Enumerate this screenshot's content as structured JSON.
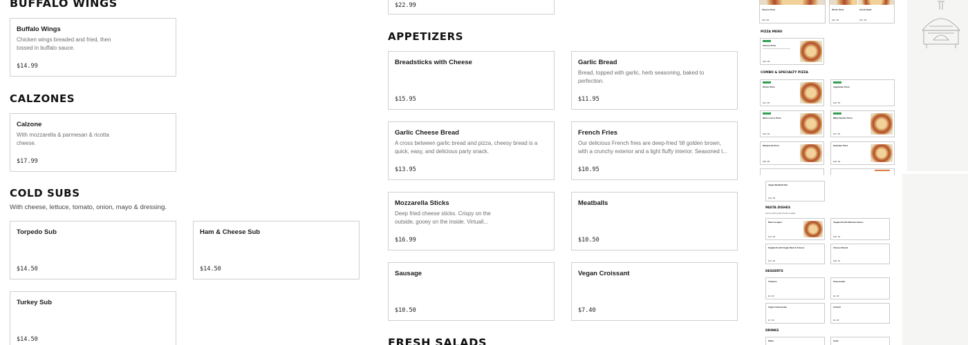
{
  "left_column": {
    "buffalo_heading": "BUFFALO WINGS",
    "buffalo_items": [
      {
        "name": "Buffalo Wings",
        "desc": "Chicken wings breaded and fried, then tossed in buffalo sauce.",
        "price": "$14.99"
      }
    ],
    "calzones_heading": "CALZONES",
    "calzone_items": [
      {
        "name": "Calzone",
        "desc": "With mozzarella & parmesan & ricotta cheese.",
        "price": "$17.99"
      }
    ],
    "cold_subs_heading": "COLD SUBS",
    "cold_subs_subtitle": "With cheese, lettuce, tomato, onion, mayo & dressing.",
    "cold_sub_items": [
      {
        "name": "Torpedo Sub",
        "price": "$14.50"
      },
      {
        "name": "Ham & Cheese Sub",
        "price": "$14.50"
      },
      {
        "name": "Turkey Sub",
        "price": "$14.50"
      }
    ]
  },
  "middle_column": {
    "top_fragment_price": "$22.99",
    "appetizers_heading": "APPETIZERS",
    "appetizer_items": [
      {
        "name": "Breadsticks with Cheese",
        "desc": "",
        "price": "$15.95"
      },
      {
        "name": "Garlic Bread",
        "desc": "Bread, topped with garlic, herb seasoning, baked to perfection.",
        "price": "$11.95"
      },
      {
        "name": "Garlic Cheese Bread",
        "desc": "A cross between garlic bread and pizza, cheesy bread is a quick, easy, and delicious party snack.",
        "price": "$13.95"
      },
      {
        "name": "French Fries",
        "desc": "Our delicious French fries are deep-fried 'till golden brown, with a crunchy exterior and a light fluffy interior. Seasoned t...",
        "price": "$10.95"
      },
      {
        "name": "Mozzarella Sticks",
        "desc": "Deep fried cheese sticks. Crispy on the outside, gooey on the inside. Virtuall...",
        "price": "$16.99"
      },
      {
        "name": "Meatballs",
        "desc": "",
        "price": "$10.50"
      },
      {
        "name": "Sausage",
        "desc": "",
        "price": "$10.50"
      },
      {
        "name": "Vegan Croissant",
        "desc": "",
        "price": "$7.40"
      }
    ],
    "fresh_salads_heading": "FRESH SALADS"
  },
  "thumbnail": {
    "sections": [
      "PIZZA MENU",
      "COMBO & SPECIALTY PIZZA",
      "PASTA DISHES",
      "DESSERTS",
      "DRINKS"
    ],
    "top_items": [
      {
        "name": "Cheese Pizza",
        "price": "$16.99"
      },
      {
        "name": "Works Pizza",
        "price": "$21.99"
      },
      {
        "name": "Greek Salad",
        "price": "$13.99"
      }
    ],
    "pizza_menu_items": [
      {
        "name": "Cheese Pizza",
        "price": "$16.99"
      }
    ],
    "combo_items": [
      {
        "name": "Works Pizza",
        "price": "$21.99"
      },
      {
        "name": "Vegetarian Pizza",
        "price": "$20.99"
      },
      {
        "name": "Meat Lover's Pizza",
        "price": "$20.99"
      },
      {
        "name": "BBQ Chicken Pizza",
        "price": "$21.99"
      },
      {
        "name": "Margherita Pizza",
        "price": "$20.99"
      },
      {
        "name": "Hawaiian Pizza",
        "price": "$20.99"
      }
    ],
    "vegan_item": {
      "name": "Vegan Meatball Sub",
      "price": "$15.99"
    },
    "pasta_subtitle": "Served with garlic bread & salad.",
    "pasta_items": [
      {
        "name": "Meat Lasagna",
        "price": "$21.99"
      },
      {
        "name": "Spaghetti with Marinara Sauce",
        "price": "$16.49"
      },
      {
        "name": "Spaghetti with Vegan Meat & Cheese",
        "price": "$21.99"
      },
      {
        "name": "Cheese Ravioli",
        "price": "$20.49"
      }
    ],
    "dessert_items": [
      {
        "name": "Tiramisu",
        "price": "$6.99"
      },
      {
        "name": "Cheesecake",
        "price": "$6.99"
      },
      {
        "name": "Vegan Cheesecake",
        "price": "$7.50"
      },
      {
        "name": "Cannoli",
        "price": "$5.99"
      }
    ],
    "drink_items": [
      {
        "name": "Water",
        "price": ""
      },
      {
        "name": "Soda",
        "price": ""
      }
    ]
  }
}
